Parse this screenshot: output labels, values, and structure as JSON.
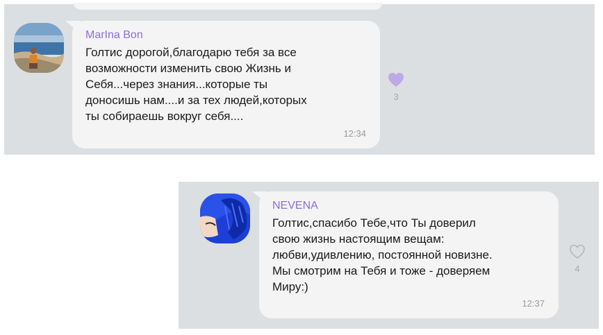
{
  "messages": [
    {
      "author": "MarIna Bon",
      "text": "Голтис дорогой,благодарю тебя за все\nвозможности изменить свою Жизнь и\nСебя...через знания...которые ты\nдоносишь нам....и за тех людей,которых\nты собираешь вокруг себя....",
      "time": "12:34",
      "likes": "3",
      "liked": true,
      "like_icon": "heart-filled-icon",
      "author_color": "#8b6fd6",
      "like_color": "#bca9e6"
    },
    {
      "author": "NEVENA",
      "text": "Голтис,спасибо Тебе,что Ты доверил\nсвою жизнь настоящим вещам:\nлюбви,удивлению, постоянной новизне.\nМы смотрим на Тебя и тоже - доверяем\nМиру:)",
      "time": "12:37",
      "likes": "4",
      "liked": false,
      "like_icon": "heart-outline-icon",
      "author_color": "#8b6fd6",
      "like_color": "#b4b6b8"
    }
  ],
  "colors": {
    "chat_background": "#dcdfe1",
    "bubble": "#f4f4f4",
    "text": "#1a1a1a",
    "timestamp": "#9a9a9a"
  }
}
